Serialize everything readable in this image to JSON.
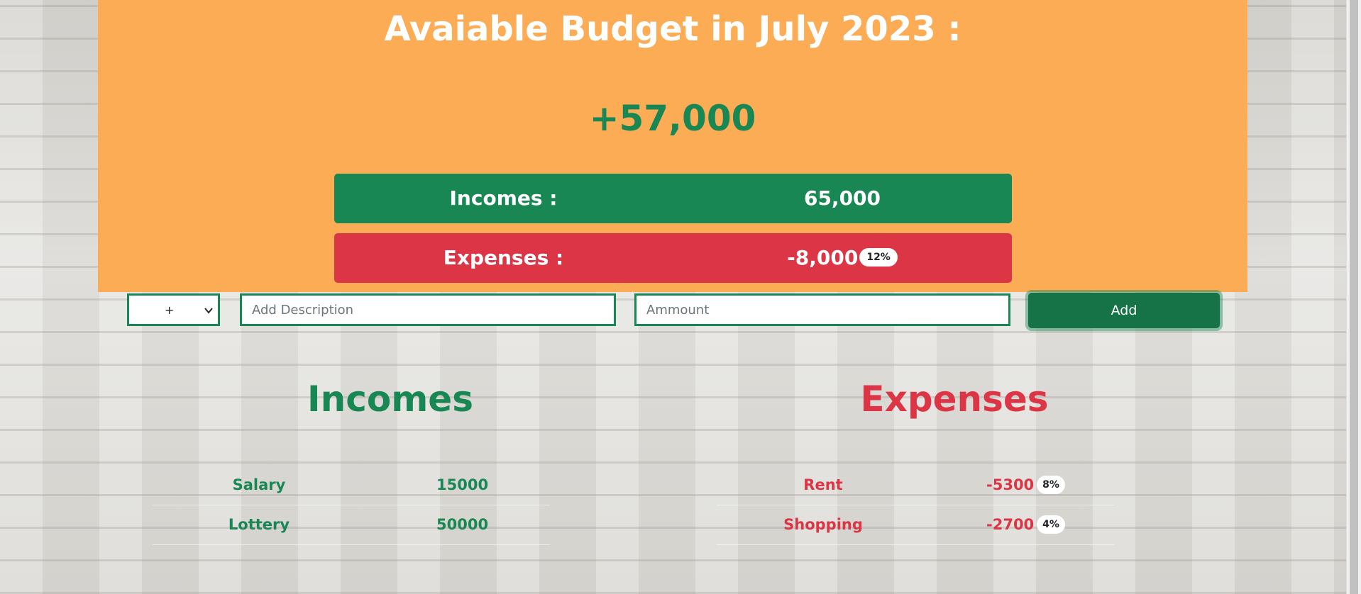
{
  "header": {
    "title": "Avaiable Budget in July 2023 :",
    "budget": "+57,000",
    "incomes_label": "Incomes :",
    "incomes_value": "65,000",
    "expenses_label": "Expenses :",
    "expenses_value": "-8,000",
    "expenses_percent": "12%"
  },
  "form": {
    "type_selected": "+",
    "description_placeholder": "Add Description",
    "amount_placeholder": "Ammount",
    "add_label": "Add"
  },
  "incomes": {
    "heading": "Incomes",
    "items": [
      {
        "description": "Salary",
        "value": "15000"
      },
      {
        "description": "Lottery",
        "value": "50000"
      }
    ]
  },
  "expenses": {
    "heading": "Expenses",
    "items": [
      {
        "description": "Rent",
        "value": "-5300",
        "percent": "8%"
      },
      {
        "description": "Shopping",
        "value": "-2700",
        "percent": "4%"
      }
    ]
  },
  "colors": {
    "header_bg": "#fcac54",
    "income_green": "#198754",
    "expense_red": "#dc3545",
    "button_green": "#157347"
  }
}
